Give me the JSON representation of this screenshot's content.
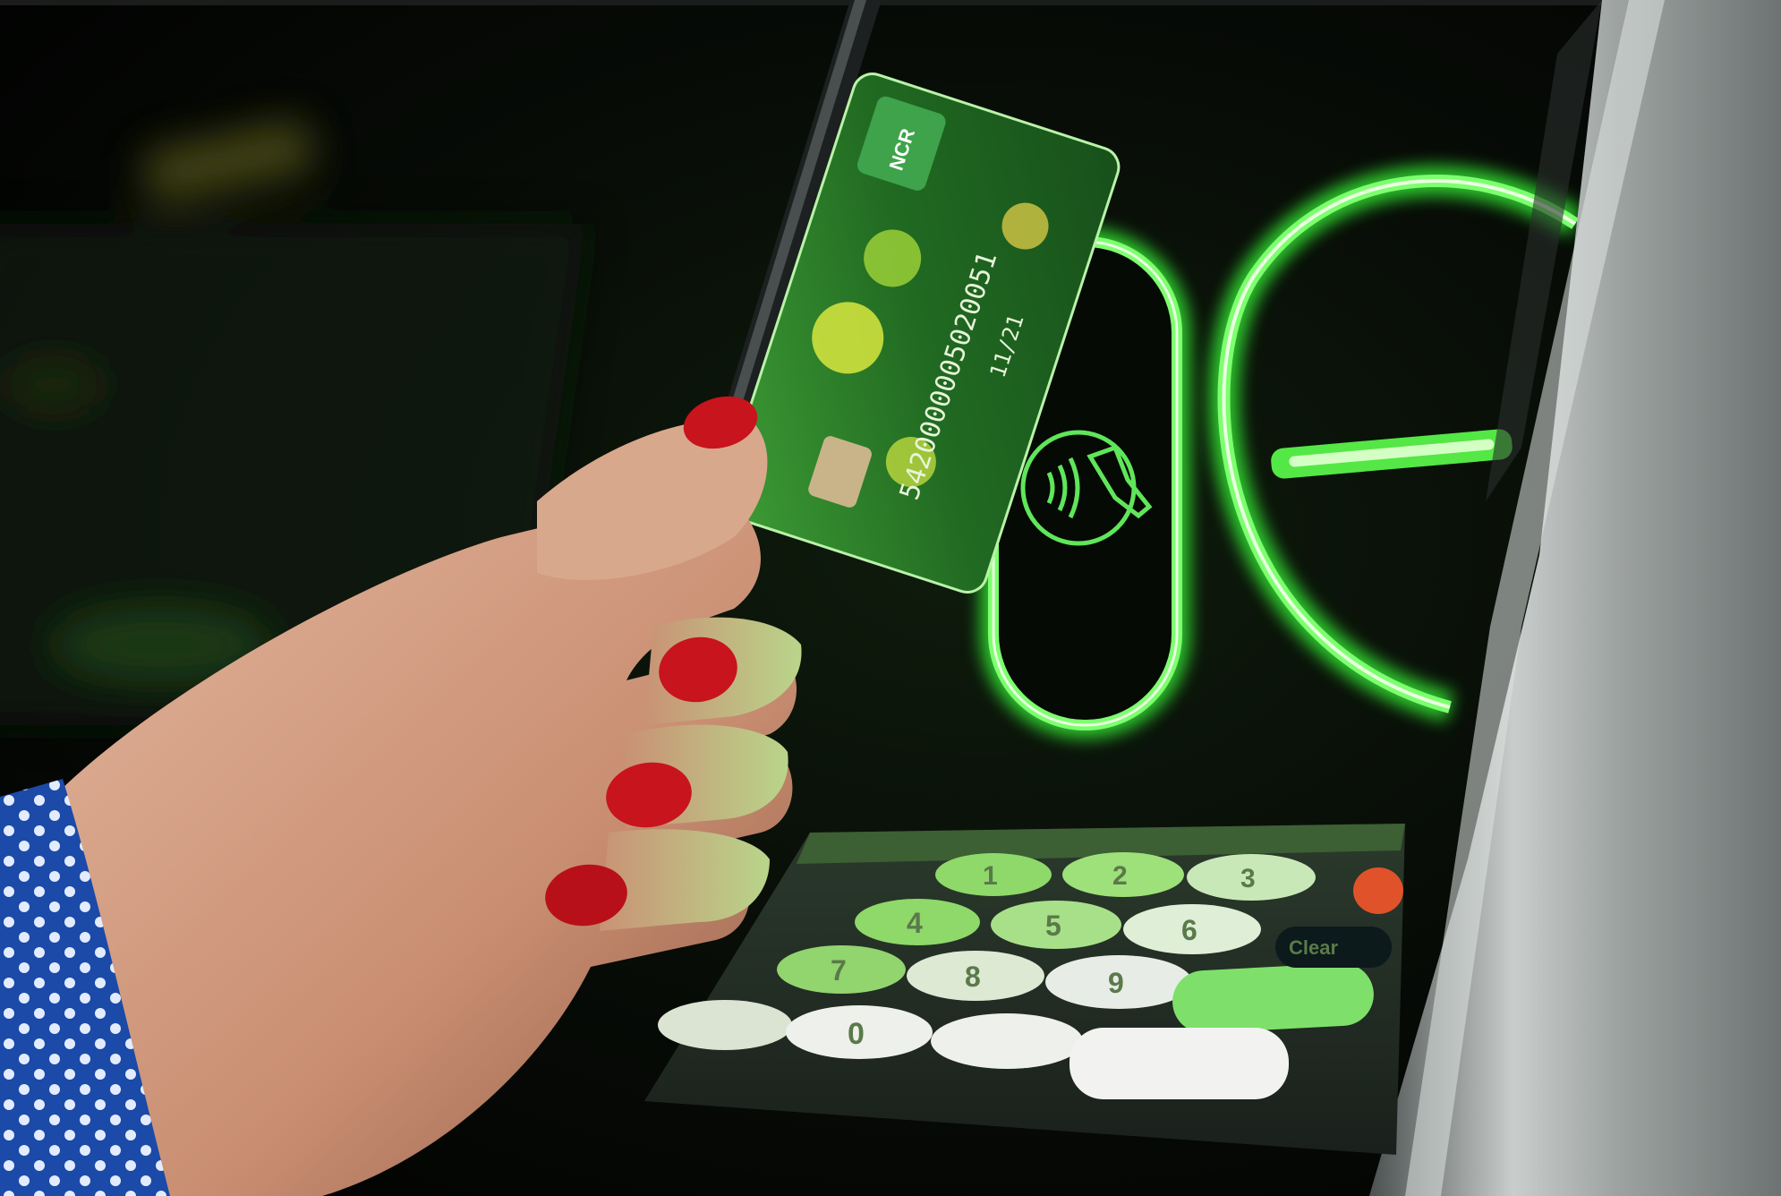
{
  "scene": {
    "subject": "atm-contactless-card-interaction",
    "colors": {
      "background": "#050805",
      "neon_green": "#4cff4c",
      "card_green": "#2f8a2a",
      "keypad_body": "#3a4440",
      "key_green": "#8fd86a",
      "key_white": "#e8ece6",
      "nail_red": "#c8141c",
      "skin": "#d9a58a",
      "sleeve_blue": "#1d4fb0",
      "atm_frame": "#b9bdbd"
    }
  },
  "card": {
    "brand_label": "NCR",
    "number_text": "5420000005020051",
    "expiry_text": "11/21",
    "icon": "contactless-card-icon"
  },
  "atm": {
    "contactless_reader_icon": "contactless-payment-icon",
    "card_slot_icon": "card-slot-icon"
  },
  "keypad": {
    "keys": [
      "1",
      "2",
      "3",
      "4",
      "5",
      "6",
      "7",
      "8",
      "9",
      "0"
    ],
    "side_key_label": "Clear"
  }
}
